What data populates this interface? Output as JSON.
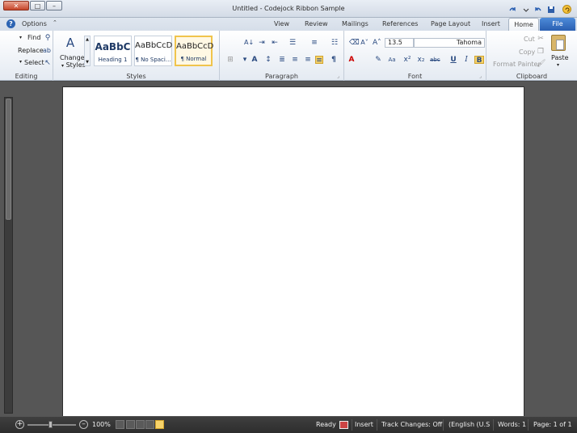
{
  "title_bar": {
    "title": "Untitled - Codejock Ribbon Sample"
  },
  "window_buttons": {
    "close": "✕",
    "restore": "□",
    "minimize": "–"
  },
  "quick_access": [
    "undo-icon",
    "redo-icon",
    "save-icon",
    "help-icon"
  ],
  "tabs_row": {
    "options_label": "Options",
    "tabs": [
      "View",
      "Review",
      "Mailings",
      "References",
      "Page Layout",
      "Insert",
      "Home",
      "File"
    ],
    "active_tab": "Home"
  },
  "ribbon": {
    "editing": {
      "label": "Editing",
      "find": "Find",
      "replace": "Replace",
      "select": "Select"
    },
    "styles": {
      "label": "Styles",
      "change_styles": "Change",
      "change_styles2": "Styles",
      "items": [
        {
          "preview": "AaBbC",
          "name": "Heading 1"
        },
        {
          "preview": "AaBbCcD",
          "name": "¶ No Spaci..."
        },
        {
          "preview": "AaBbCcD",
          "name": "¶ Normal"
        }
      ]
    },
    "paragraph": {
      "label": "Paragraph"
    },
    "font": {
      "label": "Font",
      "size": "13.5",
      "family": "Tahoma"
    },
    "clipboard": {
      "label": "Clipboard",
      "cut": "Cut",
      "copy": "Copy",
      "format_painter": "Format Painter",
      "paste": "Paste"
    }
  },
  "status_bar": {
    "zoom": "100%",
    "ready": "Ready",
    "insert": "Insert",
    "track_changes": "Track Changes: Off",
    "language": "(English (U.S",
    "words": "Words: 1",
    "page": "Page: 1 of 1"
  },
  "colors": {
    "accent": "#2a5fb1",
    "highlight": "#f0c44c",
    "page": "#ffffff",
    "workspace": "#565656"
  }
}
